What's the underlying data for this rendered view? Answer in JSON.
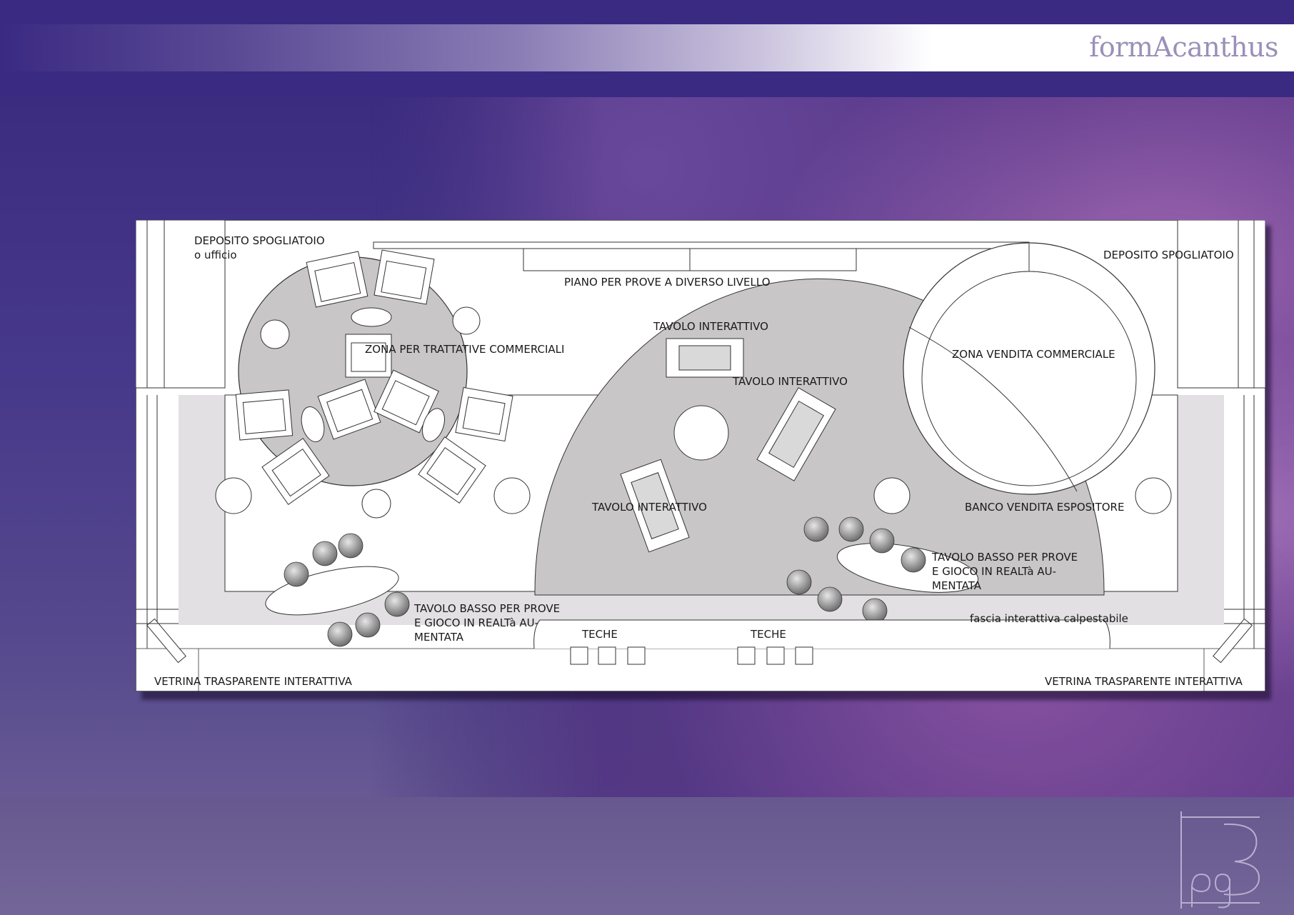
{
  "brand": {
    "logo_text": "formAcanthus"
  },
  "page": {
    "number_label": "pg3"
  },
  "colors": {
    "header_dark": "#3a2a82",
    "plan_floor": "#ffffff",
    "zone_grey": "#c9c6c8",
    "strip_grey": "#e2e0e2"
  },
  "plan": {
    "labels": {
      "deposito_left_1": "DEPOSITO SPOGLIATOIO",
      "deposito_left_2": "o ufficio",
      "deposito_right": "DEPOSITO SPOGLIATOIO",
      "piano_prove": "PIANO PER PROVE A DIVERSO LIVELLO",
      "tavolo_top": "TAVOLO INTERATTIVO",
      "tavolo_mid": "TAVOLO INTERATTIVO",
      "tavolo_low": "TAVOLO INTERATTIVO",
      "zona_trattative": "ZONA PER TRATTATIVE COMMERCIALI",
      "zona_vendita": "ZONA VENDITA COMMERCIALE",
      "banco_vendita": "BANCO VENDITA ESPOSITORE",
      "tavolo_basso_right_1": "TAVOLO BASSO PER PROVE",
      "tavolo_basso_right_2": "E GIOCO IN REALTà AU-",
      "tavolo_basso_right_3": "MENTATA",
      "tavolo_basso_left_1": "TAVOLO BASSO PER PROVE",
      "tavolo_basso_left_2": "E GIOCO IN REALTà AU-",
      "tavolo_basso_left_3": "MENTATA",
      "fascia": "fascia interattiva calpestabile",
      "teche_left": "TECHE",
      "teche_right": "TECHE",
      "vetrina_left": "VETRINA TRASPARENTE INTERATTIVA",
      "vetrina_right": "VETRINA TRASPARENTE INTERATTIVA"
    }
  }
}
